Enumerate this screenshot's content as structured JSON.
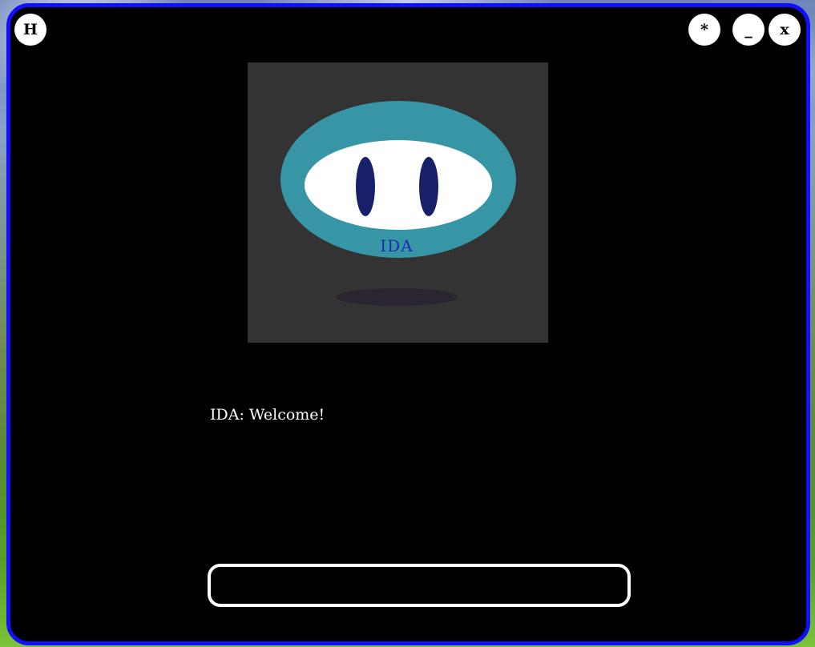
{
  "window": {
    "home_label": "H",
    "settings_label": "*",
    "minimize_label": "_",
    "close_label": "x"
  },
  "avatar": {
    "logo_text": "IDA",
    "colors": {
      "panel": "#333333",
      "head": "#3796a6",
      "face": "#ffffff",
      "eyes": "#18206a",
      "logo": "#1b2bb0",
      "shadow": "#2a2530"
    }
  },
  "chat": {
    "message": "IDA: Welcome!",
    "input_value": "",
    "input_placeholder": ""
  },
  "colors": {
    "window_border": "#1010ff",
    "window_bg": "#000000"
  }
}
